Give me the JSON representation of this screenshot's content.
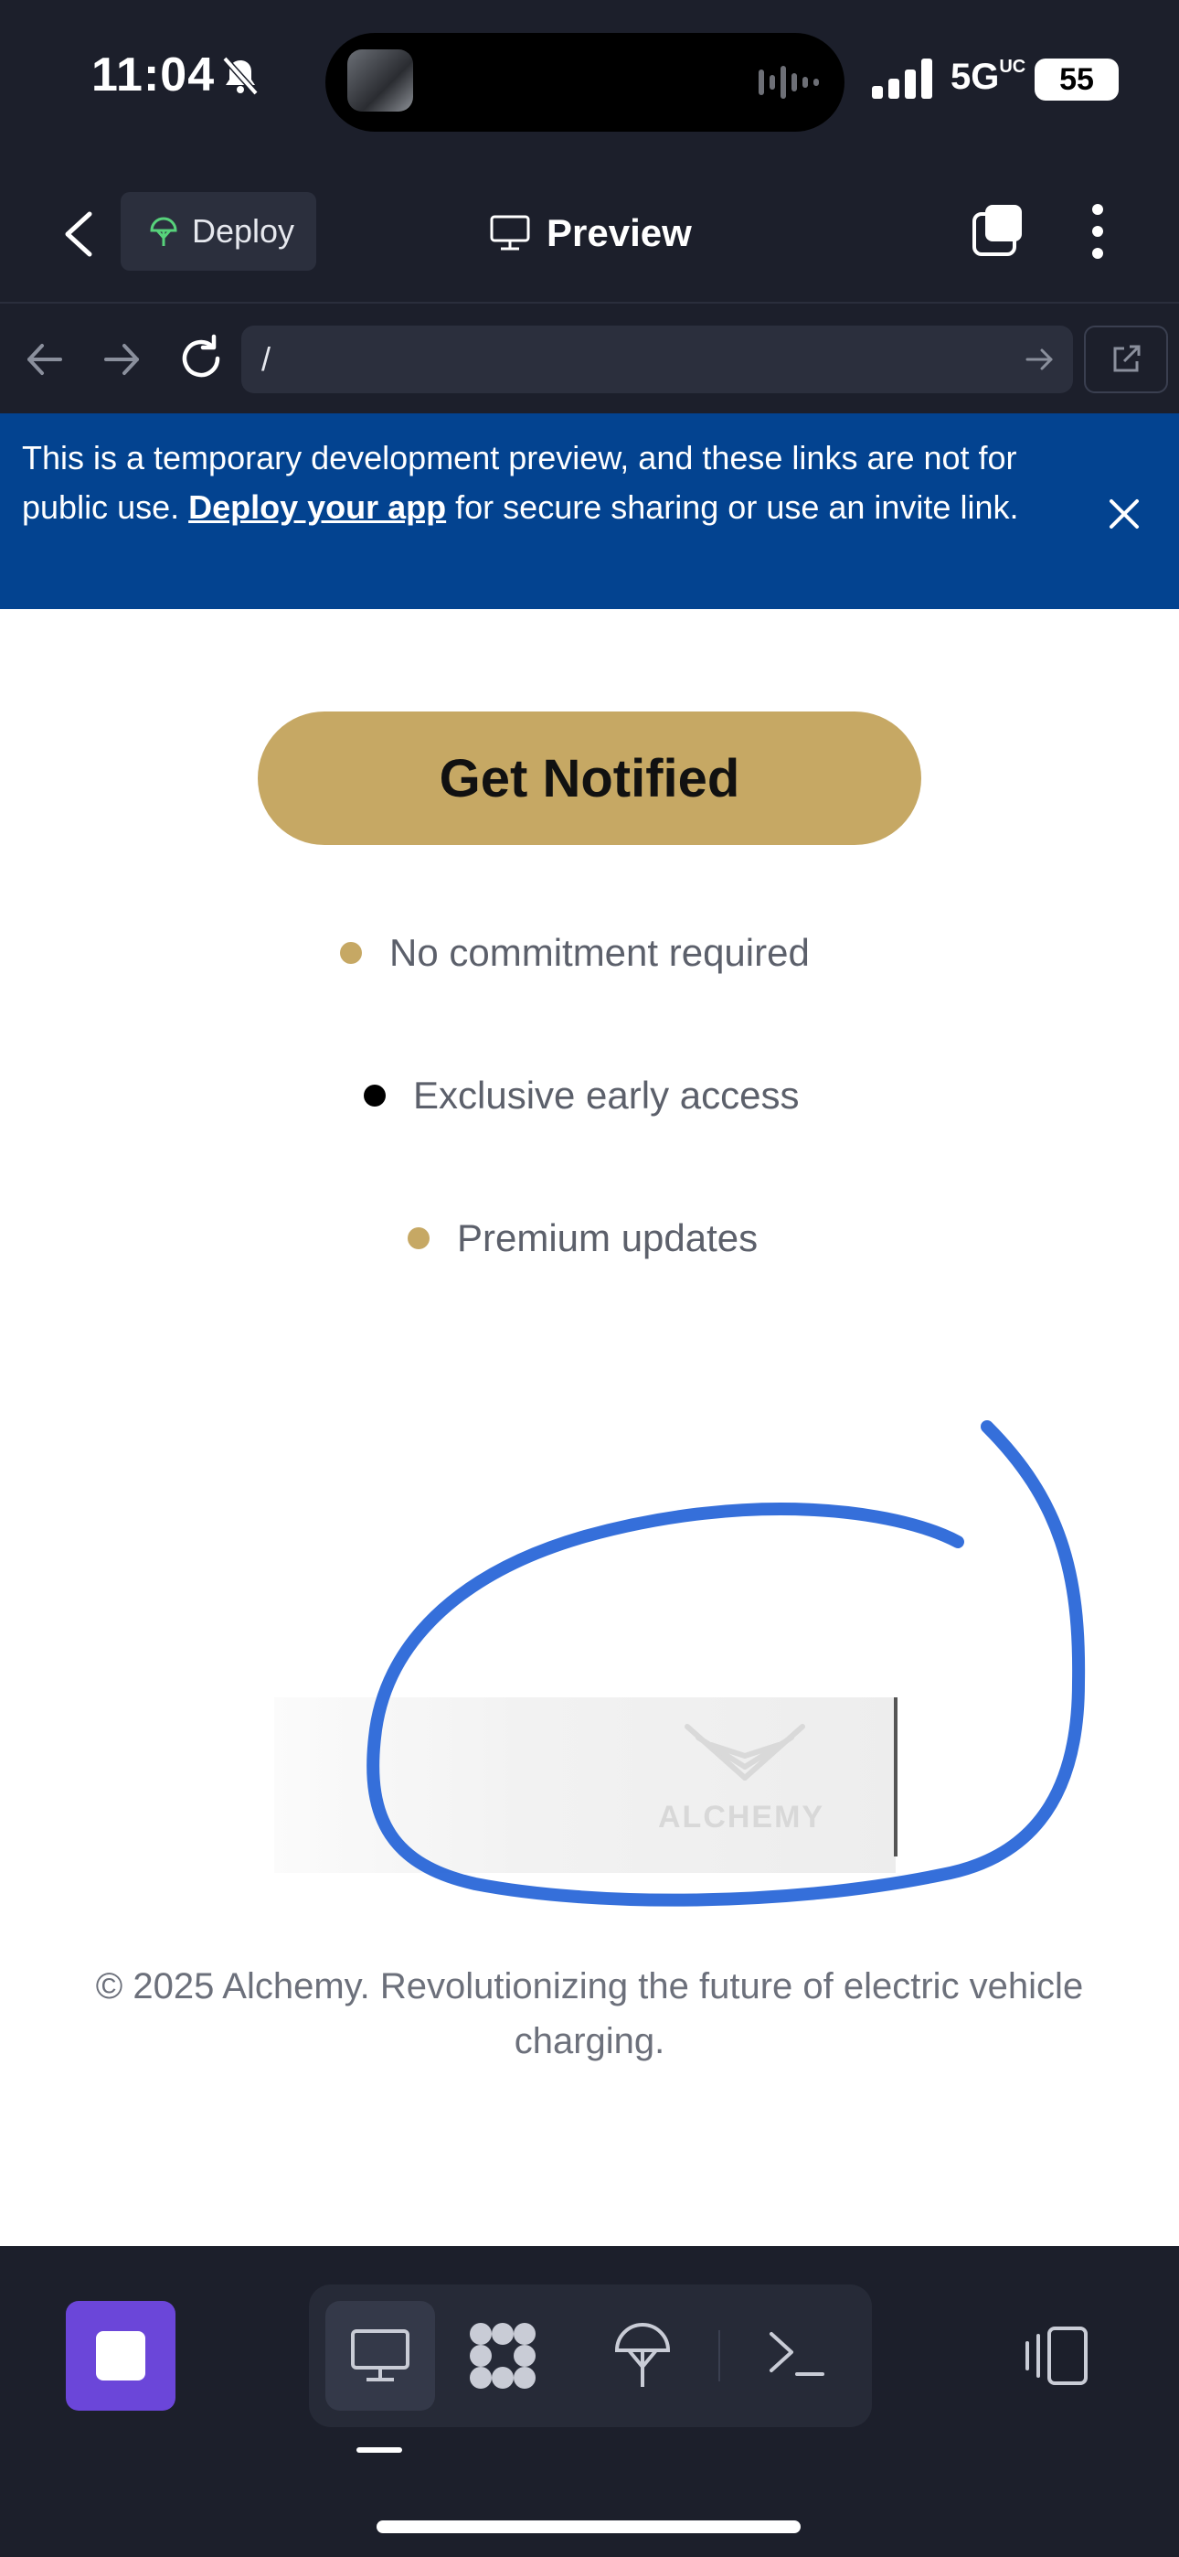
{
  "status_bar": {
    "time": "11:04",
    "network": "5G",
    "network_suffix": "UC",
    "battery": "55"
  },
  "header": {
    "deploy_label": "Deploy",
    "title": "Preview"
  },
  "url_bar": {
    "path": "/"
  },
  "banner": {
    "text_before": "This is a temporary development preview, and these links are not for public use. ",
    "link": "Deploy your app",
    "text_after": " for secure sharing or use an invite link."
  },
  "page": {
    "cta_label": "Get Notified",
    "bullets": [
      {
        "label": "No commitment required",
        "dot_color": "#c6a864"
      },
      {
        "label": "Exclusive early access",
        "dot_color": "#000000"
      },
      {
        "label": "Premium updates",
        "dot_color": "#c6a864"
      }
    ],
    "logo_text": "ALCHEMY",
    "footer": "© 2025 Alchemy. Revolutionizing the future of electric vehicle charging."
  },
  "colors": {
    "accent_gold": "#c6a864",
    "banner_blue": "#034390",
    "annotation_blue": "#1f5fd6",
    "stop_purple": "#6b46d9"
  }
}
